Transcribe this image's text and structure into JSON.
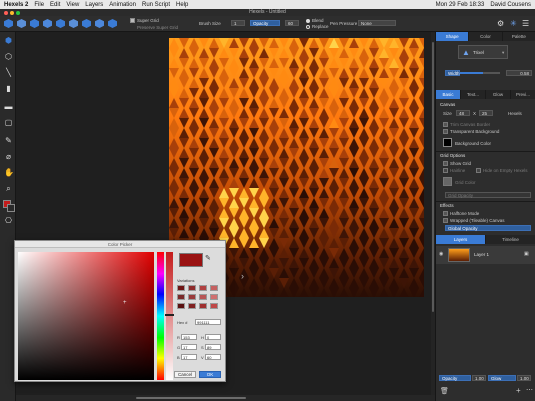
{
  "menubar": {
    "apple": "",
    "app": "Hexels 2",
    "items": [
      "File",
      "Edit",
      "View",
      "Layers",
      "Animation",
      "Run Script",
      "Help"
    ],
    "clock": "Mon 29 Feb 18:33",
    "user": "David Cousens"
  },
  "window": {
    "title": "Hexels - Untitled"
  },
  "toolbar": {
    "super_grid": "Super Grid",
    "preserve_super_grid": "Preserve Super Grid",
    "brush_size_label": "Brush Size",
    "brush_size_value": "1",
    "opacity_label": "Opacity",
    "opacity_value": "60",
    "blend": "Blend",
    "replace": "Replace",
    "pen_pressure_label": "Pen Pressure",
    "pen_pressure_value": "None"
  },
  "shape_panel": {
    "tabs": [
      "Shape",
      "Color",
      "Palette"
    ],
    "shape_value": "Trixel",
    "width_label": "Width",
    "width_value": "0.58"
  },
  "canvas_panel": {
    "tabs": [
      "Basic",
      "Text...",
      "Glow",
      "Previ..."
    ],
    "canvas_heading": "Canvas",
    "size_label": "Size",
    "size_w": "48",
    "size_x": "X",
    "size_h": "25",
    "hexels_label": "Hexels",
    "trim_canvas_border": "Trim Canvas Border",
    "transparent_background": "Transparent Background",
    "background_color": "Background Color",
    "grid_heading": "Grid Options",
    "show_grid": "Show Grid",
    "hairline": "Hairline",
    "hide_on_empty": "Hide on Empty Hexels",
    "grid_color": "Grid Color",
    "grid_opacity": "Grid Opacity",
    "effects_heading": "Effects",
    "halftone_mode": "Halftone Mode",
    "wrapped_canvas": "Wrapped (Tileable) Canvas",
    "global_opacity": "Global Opacity"
  },
  "layers_panel": {
    "tabs": [
      "Layers",
      "Timeline"
    ],
    "layer_name": "Layer 1",
    "opacity_label": "Opacity",
    "opacity_value": "1.00",
    "glow_label": "Glow",
    "glow_value": "1.00"
  },
  "color_picker": {
    "title": "Color Picker",
    "variations_label": "Variations",
    "hex_label": "Hex #",
    "hex_value": "991111",
    "r_label": "R",
    "r_value": "153",
    "g_label": "G",
    "g_value": "17",
    "b_label": "B",
    "b_value": "17",
    "h_label": "H",
    "h_value": "0",
    "s_label": "S",
    "s_value": "89",
    "v_label": "V",
    "v_value": "60",
    "cancel": "Cancel",
    "ok": "OK",
    "current_color": "#991111",
    "variations": [
      "#6e1515",
      "#8e2b2b",
      "#b04040",
      "#c66060",
      "#7a2a2a",
      "#9a3a3a",
      "#b85555",
      "#d07070",
      "#5a1010",
      "#802020",
      "#a03030",
      "#c04848"
    ]
  },
  "colors": {
    "accent": "#3a7bd5",
    "primary_color": "#c41b1b",
    "secondary_color": "#2a2a2a"
  },
  "icons": {
    "tools": [
      "hex-select-icon",
      "hex-lasso-icon",
      "line-icon",
      "fill-icon",
      "rect-icon",
      "eyedropper-icon",
      "hand-icon",
      "zoom-icon",
      "transform-icon",
      "color-swatch-icon"
    ]
  }
}
